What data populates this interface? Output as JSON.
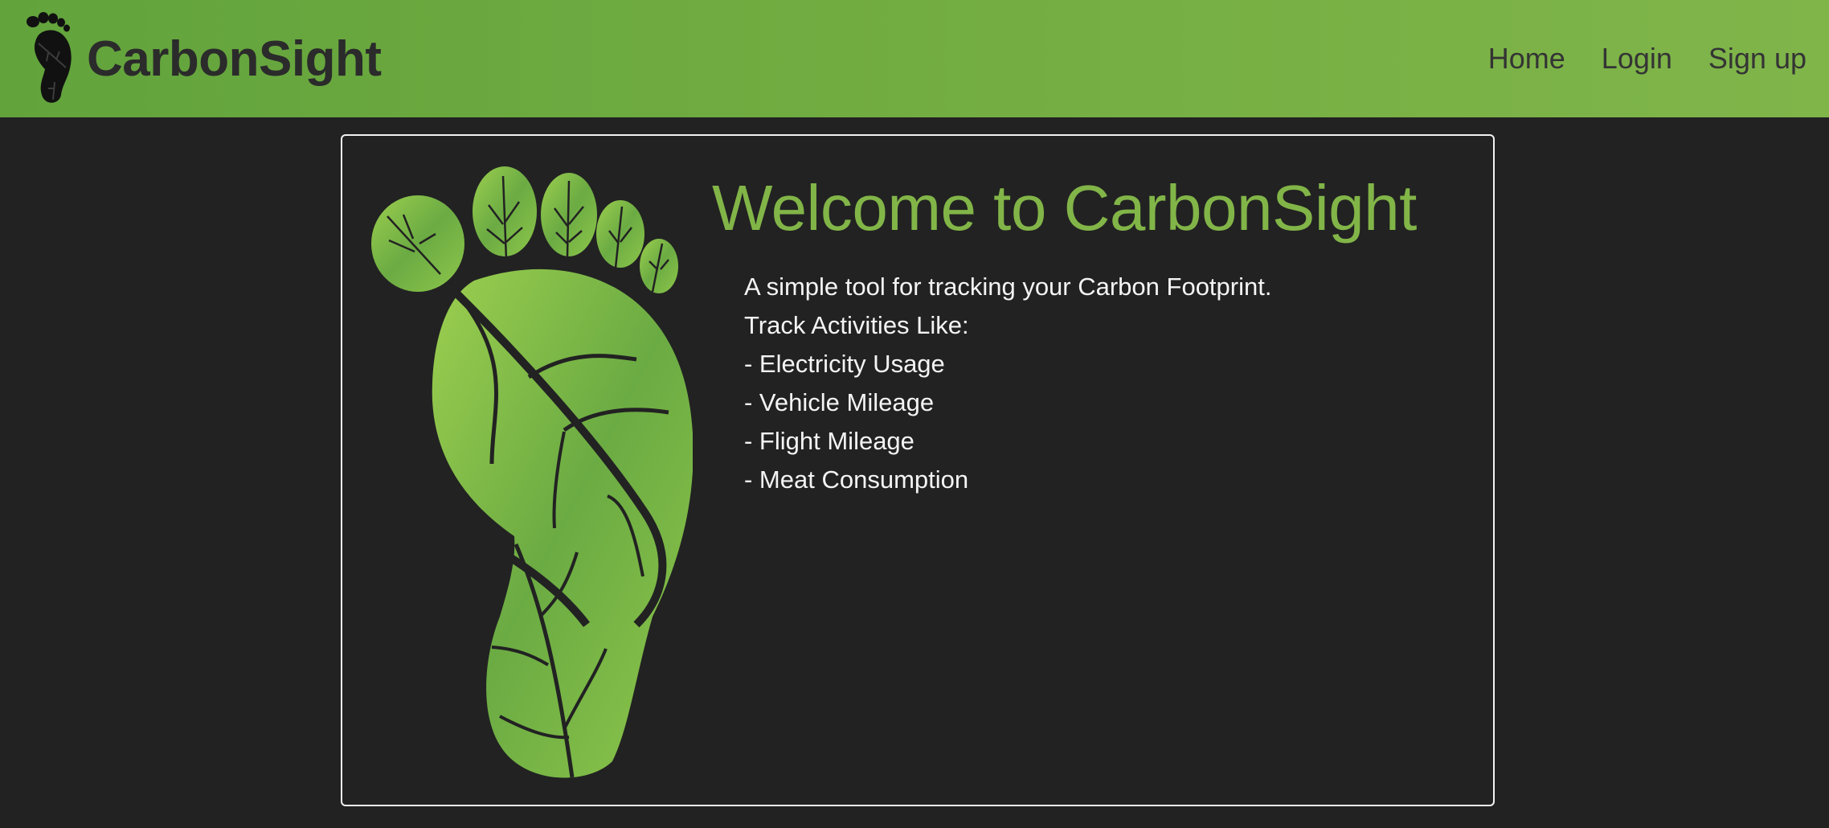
{
  "nav": {
    "brand": "CarbonSight",
    "links": [
      {
        "label": "Home"
      },
      {
        "label": "Login"
      },
      {
        "label": "Sign up"
      }
    ]
  },
  "hero": {
    "title": "Welcome to CarbonSight",
    "tagline": "A simple tool for tracking your Carbon Footprint.",
    "activities_heading": "Track Activities Like:",
    "activities": [
      "- Electricity Usage",
      "- Vehicle Mileage",
      "- Flight Mileage",
      "- Meat Consumption"
    ]
  },
  "icons": {
    "brand_logo": "footprint-leaf-icon",
    "hero_image": "footprint-leaf-illustration"
  },
  "colors": {
    "navbar_green": "#74ae42",
    "title_green": "#82b548",
    "background": "#222222",
    "brand_text": "#2b2b2b"
  }
}
